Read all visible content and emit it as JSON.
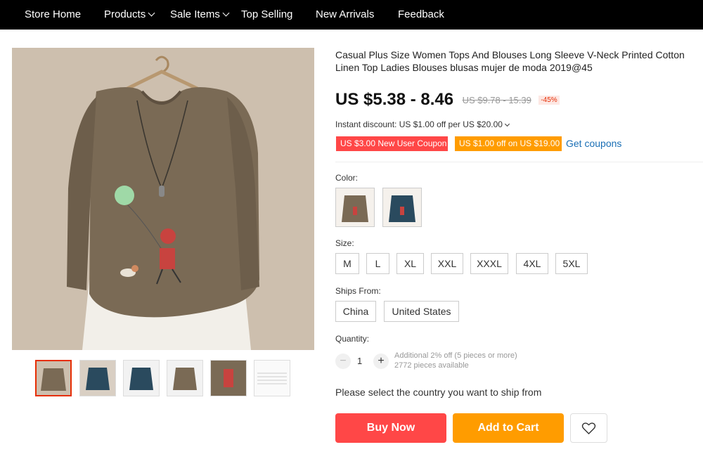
{
  "nav": {
    "items": [
      {
        "label": "Store Home"
      },
      {
        "label": "Products"
      },
      {
        "label": "Sale Items"
      },
      {
        "label": "Top Selling"
      },
      {
        "label": "New Arrivals"
      },
      {
        "label": "Feedback"
      }
    ]
  },
  "product": {
    "title": "Casual Plus Size Women Tops And Blouses Long Sleeve V-Neck Printed Cotton Linen Top Ladies Blouses blusas mujer de moda 2019@45",
    "price": "US $5.38 - 8.46",
    "old_price": "US $9.78 - 15.39",
    "discount": "-45%",
    "instant_discount": "Instant discount: US $1.00 off per US $20.00",
    "coupons": [
      "US $3.00 New User Coupon",
      "US $1.00 off on US $19.00"
    ],
    "get_coupons": "Get coupons"
  },
  "options": {
    "color_label": "Color:",
    "colors": [
      "brown",
      "navy"
    ],
    "size_label": "Size:",
    "sizes": [
      "M",
      "L",
      "XL",
      "XXL",
      "XXXL",
      "4XL",
      "5XL"
    ],
    "ships_label": "Ships From:",
    "ships": [
      "China",
      "United States"
    ],
    "quantity_label": "Quantity:",
    "quantity": "1",
    "qty_minus": "−",
    "qty_plus": "+",
    "qty_note": "Additional 2% off (5 pieces or more)",
    "available": "2772 pieces available"
  },
  "ship_note": "Please select the country you want to ship from",
  "actions": {
    "buy_now": "Buy Now",
    "add_to_cart": "Add to Cart"
  },
  "colors": {
    "nav_bg": "#000000",
    "buy": "#ff4747",
    "cart": "#ff9c00",
    "shirt_brown": "#7a6a55",
    "shirt_navy": "#2a4a5e"
  }
}
